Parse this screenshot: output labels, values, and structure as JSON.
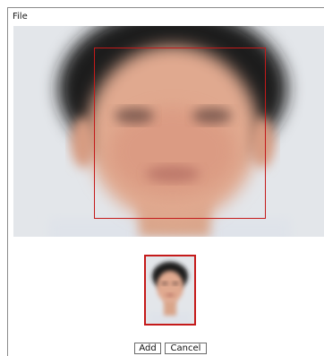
{
  "menubar": {
    "file_label": "File"
  },
  "photo": {
    "icon": "blurred-face-photo",
    "box_color": "#c41a1a"
  },
  "thumbnail": {
    "icon": "face-crop-thumbnail",
    "border_color": "#c41a1a"
  },
  "buttons": {
    "add_label": "Add",
    "cancel_label": "Cancel"
  }
}
